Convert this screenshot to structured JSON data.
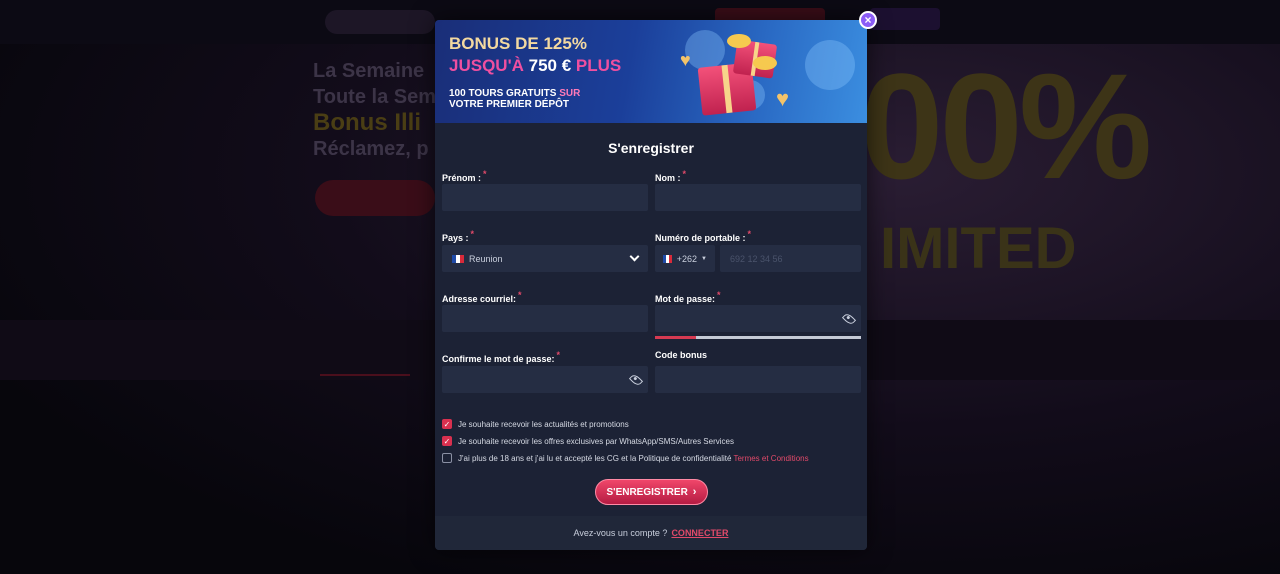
{
  "background": {
    "hero_line1": "La Semaine",
    "hero_line2": "Toute la Sema",
    "hero_line3": "Bonus Illi",
    "hero_line4": "Réclamez, p",
    "big_text": "00%",
    "limited_text": "IMITED"
  },
  "banner": {
    "line1": "BONUS DE 125%",
    "line2_prefix": "JUSQU'À",
    "line2_amount": "750 €",
    "line2_suffix": "PLUS",
    "line3_a": "100 TOURS GRATUITS",
    "line3_b": "SUR",
    "line3_c": "VOTRE PREMIER DÉPÔT"
  },
  "form": {
    "title": "S'enregistrer",
    "required_mark": "*",
    "first_name": {
      "label": "Prénom :",
      "value": ""
    },
    "last_name": {
      "label": "Nom :",
      "value": ""
    },
    "country": {
      "label": "Pays :",
      "value": "Reunion"
    },
    "phone": {
      "label": "Numéro de portable :",
      "code": "+262",
      "placeholder": "692 12 34 56"
    },
    "email": {
      "label": "Adresse courriel:",
      "value": ""
    },
    "password": {
      "label": "Mot de passe:",
      "value": "",
      "strength": 0.2
    },
    "confirm_password": {
      "label": "Confirme le mot de passe:",
      "value": ""
    },
    "bonus_code": {
      "label": "Code bonus",
      "value": ""
    },
    "checkboxes": [
      {
        "label": "Je souhaite recevoir les actualités et promotions",
        "checked": true
      },
      {
        "label": "Je souhaite recevoir les offres exclusives par WhatsApp/SMS/Autres Services",
        "checked": true
      },
      {
        "label": "J'ai plus de 18 ans et j'ai lu et accepté les CG et la Politique de confidentialité",
        "checked": false,
        "link": "Termes et Conditions"
      }
    ],
    "submit_label": "S'ENREGISTRER",
    "submit_arrow": "›",
    "footer_text": "Avez-vous un compte ?",
    "footer_link": "CONNECTER"
  },
  "close_icon": "×",
  "colors": {
    "accent": "#e24a6a",
    "modal_bg": "#1c2235",
    "input_bg": "#252d43"
  }
}
